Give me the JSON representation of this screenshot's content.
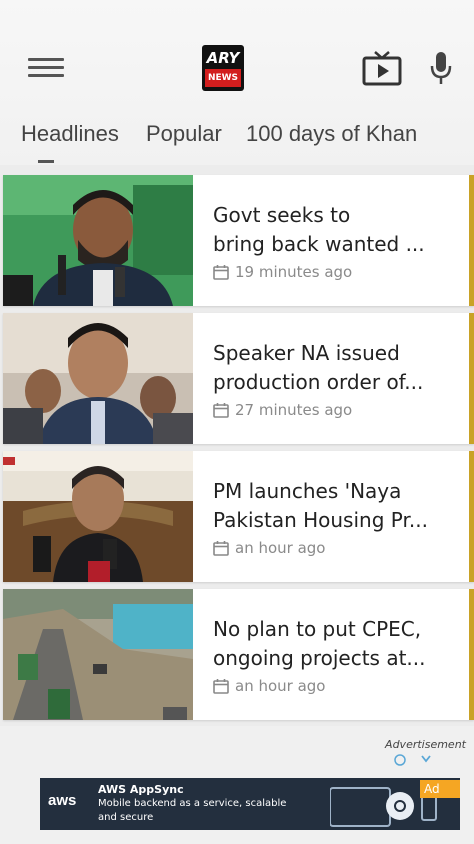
{
  "app": {
    "logo_top": "ARY",
    "logo_bottom": "NEWS"
  },
  "tabs": [
    {
      "label": "Headlines"
    },
    {
      "label": "Popular"
    },
    {
      "label": "100 days of Khan"
    }
  ],
  "articles": [
    {
      "title_line1": "Govt seeks to",
      "title_line2": "bring back wanted ...",
      "time": "19 minutes ago",
      "thumb": "press-conference-green"
    },
    {
      "title_line1": "Speaker NA issued",
      "title_line2": "production order of...",
      "time": "27 minutes ago",
      "thumb": "politician-outdoors"
    },
    {
      "title_line1": "PM launches 'Naya",
      "title_line2": "Pakistan Housing Pr...",
      "time": "an hour ago",
      "thumb": "pm-podium"
    },
    {
      "title_line1": "No plan to put CPEC,",
      "title_line2": "ongoing projects at...",
      "time": "an hour ago",
      "thumb": "mountain-highway"
    }
  ],
  "ad": {
    "label": "Advertisement",
    "brand": "aws",
    "title": "AWS AppSync",
    "text": "Mobile backend as a service, scalable and secure",
    "badge": "Ad"
  },
  "colors": {
    "accent": "#c9a227",
    "logo_red": "#d21e1e",
    "ad_bg": "#232f3e",
    "ad_badge": "#f5a623"
  },
  "icons": [
    "menu-icon",
    "tv-icon",
    "microphone-icon",
    "calendar-icon",
    "adchoices-icon"
  ]
}
